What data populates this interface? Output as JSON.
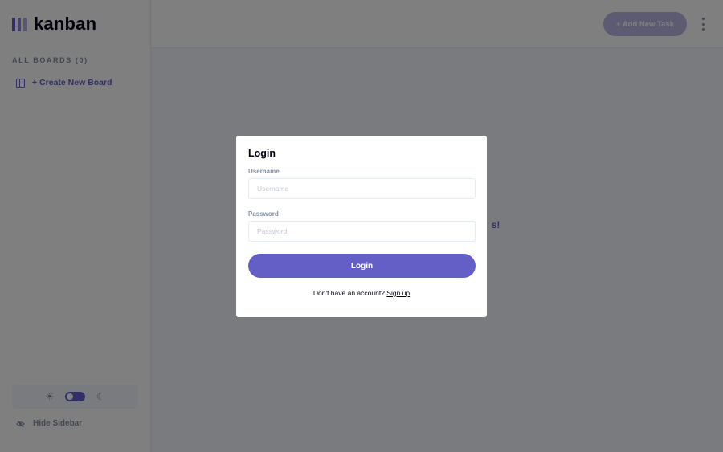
{
  "app": {
    "logo_text": "kanban"
  },
  "sidebar": {
    "boards_heading": "ALL BOARDS (0)",
    "create_board_label": "+ Create New Board",
    "hide_sidebar_label": "Hide Sidebar",
    "theme": {
      "sun_icon": "sun-icon",
      "moon_icon": "moon-icon",
      "dark_mode": true
    }
  },
  "header": {
    "add_task_label": "+ Add New Task",
    "menu_icon": "kebab-icon"
  },
  "main": {
    "empty_message_visible": "s!"
  },
  "modal": {
    "title": "Login",
    "username": {
      "label": "Username",
      "placeholder": "Username",
      "value": ""
    },
    "password": {
      "label": "Password",
      "placeholder": "Password",
      "value": ""
    },
    "submit_label": "Login",
    "signup_prompt": "Don't have an account?",
    "signup_link": "Sign up"
  },
  "colors": {
    "accent": "#635fc7",
    "background": "#f4f7fd",
    "text_primary": "#000112",
    "text_muted": "#828fa3",
    "overlay": "rgba(0,0,0,0.5)"
  }
}
